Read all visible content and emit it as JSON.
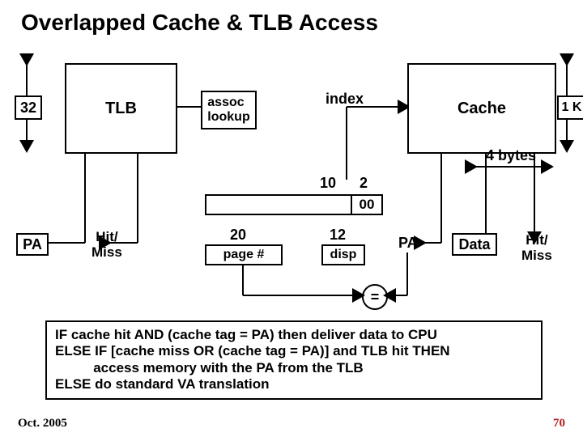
{
  "title": "Overlapped Cache & TLB Access",
  "tlb_width": "32",
  "tlb_label": "TLB",
  "assoc_lookup": "assoc\nlookup",
  "index_label": "index",
  "cache_label": "Cache",
  "cache_size": "1 K",
  "four_bytes": "4 bytes",
  "ten": "10",
  "two": "2",
  "zeros": "00",
  "pa_left": "PA",
  "hit_miss_left": "Hit/\nMiss",
  "twenty": "20",
  "page_num": "page #",
  "twelve": "12",
  "disp": "disp",
  "pa_right": "PA",
  "data_label": "Data",
  "hit_miss_right": "Hit/\nMiss",
  "equals": "=",
  "pseudocode": "IF cache hit AND (cache tag = PA) then deliver data to CPU\nELSE IF [cache miss OR (cache tag = PA)] and TLB hit THEN\n          access memory with the PA from the TLB\nELSE do standard VA translation",
  "footer_date": "Oct. 2005",
  "footer_page": "70"
}
